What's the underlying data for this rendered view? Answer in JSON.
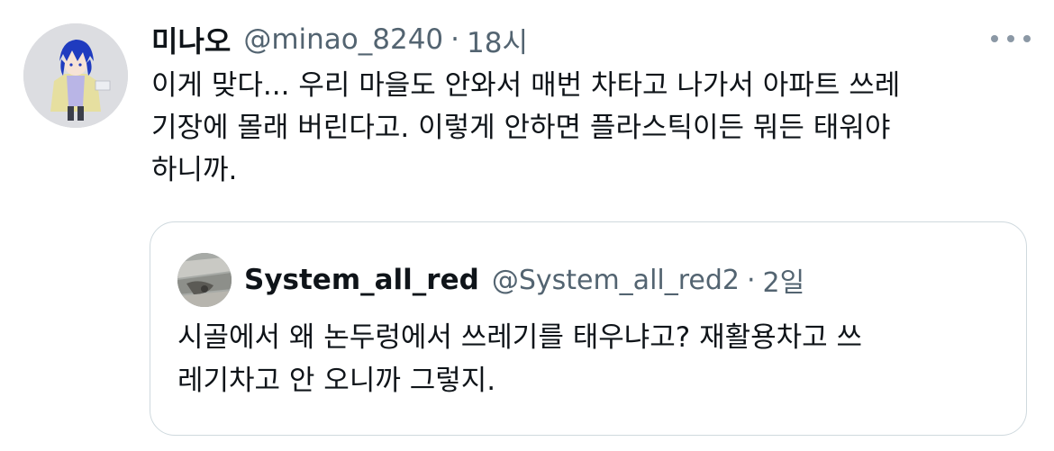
{
  "tweet": {
    "author": {
      "display_name": "미나오",
      "handle": "@minao_8240",
      "avatar_icon": "anime-character-avatar-icon"
    },
    "separator": "·",
    "time": "18시",
    "text": "이게 맞다... 우리 마을도 안와서 매번 차타고 나가서 아파트 쓰레\n기장에 몰래 버린다고. 이렇게 안하면 플라스틱이든 뭐든 태워야\n하니까.",
    "more_icon": "more-horizontal-icon"
  },
  "quote": {
    "author": {
      "display_name": "System_all_red",
      "handle": "@System_all_red2",
      "avatar_icon": "photo-avatar-icon"
    },
    "separator": "·",
    "time": "2일",
    "text": "시골에서 왜 논두렁에서 쓰레기를 태우냐고? 재활용차고 쓰\n레기차고 안 오니까 그렇지."
  },
  "colors": {
    "text_primary": "#0f1419",
    "text_secondary": "#536471",
    "border": "#cfd9de"
  }
}
